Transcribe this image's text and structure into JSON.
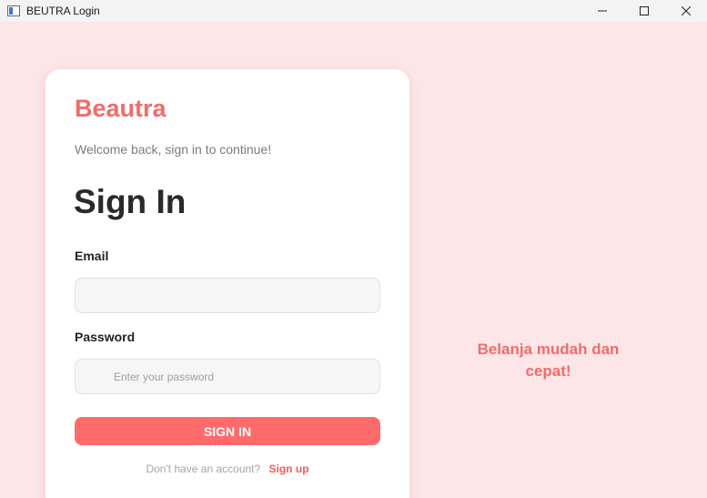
{
  "window": {
    "title": "BEUTRA Login",
    "controls": [
      "minimize-icon",
      "maximize-icon",
      "close-icon"
    ]
  },
  "card": {
    "brand": "Beautra",
    "welcome": "Welcome back, sign in to continue!",
    "heading": "Sign In",
    "email": {
      "label": "Email",
      "value": "",
      "placeholder": ""
    },
    "password": {
      "label": "Password",
      "value": "",
      "placeholder": "Enter your password"
    },
    "signin_button": "SIGN IN",
    "signup_prompt": "Don't have an account?",
    "signup_link": "Sign up"
  },
  "tagline": "Belanja mudah dan cepat!",
  "colors": {
    "background": "#fde6e7",
    "accent": "#ff6b6b",
    "brand": "#f26b6b",
    "card": "#ffffff"
  }
}
